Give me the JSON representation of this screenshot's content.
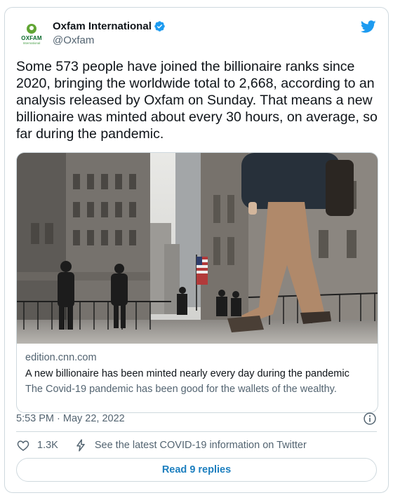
{
  "account": {
    "name": "Oxfam International",
    "handle": "@Oxfam",
    "avatar_brand": "OXFAM",
    "avatar_sub": "International"
  },
  "tweet": {
    "text": "Some 573 people have joined the billionaire ranks since 2020, bringing the worldwide total to 2,668, according to an analysis released by Oxfam on Sunday. That means a new billionaire was minted about every 30 hours, on average, so far during the pandemic.",
    "timestamp": "5:53 PM · May 22, 2022"
  },
  "link_card": {
    "domain": "edition.cnn.com",
    "title": "A new billionaire has been minted nearly every day during the pandemic",
    "description": "The Covid-19 pandemic has been good for the wallets of the wealthy."
  },
  "actions": {
    "likes": "1.3K",
    "covid_link": "See the latest COVID-19 information on Twitter",
    "read_replies": "Read 9 replies"
  },
  "colors": {
    "twitter_blue": "#1d9bf0",
    "oxfam_green": "#61a534",
    "muted_text": "#536471",
    "border": "#cfd9de"
  },
  "icons": [
    "oxfam-logo-icon",
    "verified-badge-icon",
    "twitter-bird-icon",
    "info-icon",
    "heart-icon",
    "bolt-icon"
  ]
}
